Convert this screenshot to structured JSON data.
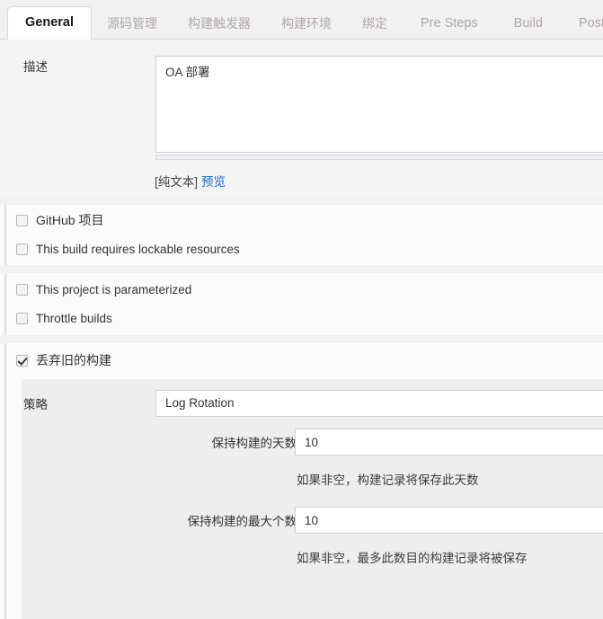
{
  "tabs": [
    {
      "label": "General",
      "active": true,
      "cjk": false
    },
    {
      "label": "源码管理",
      "active": false,
      "cjk": true
    },
    {
      "label": "构建触发器",
      "active": false,
      "cjk": true
    },
    {
      "label": "构建环境",
      "active": false,
      "cjk": true
    },
    {
      "label": "绑定",
      "active": false,
      "cjk": true
    },
    {
      "label": "Pre Steps",
      "active": false,
      "cjk": false
    },
    {
      "label": "Build",
      "active": false,
      "cjk": false
    },
    {
      "label": "Post Steps",
      "active": false,
      "cjk": false
    }
  ],
  "description": {
    "label": "描述",
    "value": "OA 部署",
    "placeholder": "",
    "plain_text_note": "[纯文本]",
    "preview_link": "预览"
  },
  "checkboxes": [
    {
      "label": "GitHub 项目",
      "checked": false,
      "cjk": true
    },
    {
      "label": "This build requires lockable resources",
      "checked": false,
      "cjk": false
    },
    {
      "label": "This project is parameterized",
      "checked": false,
      "cjk": false
    },
    {
      "label": "Throttle builds",
      "checked": false,
      "cjk": false
    },
    {
      "label": "丢弃旧的构建",
      "checked": true,
      "cjk": true
    }
  ],
  "strategy": {
    "label": "策略",
    "selected": "Log Rotation",
    "days_to_keep": {
      "label": "保持构建的天数",
      "value": "10",
      "hint": "如果非空，构建记录将保存此天数"
    },
    "max_to_keep": {
      "label": "保持构建的最大个数",
      "value": "10",
      "hint": "如果非空，最多此数目的构建记录将被保存"
    }
  },
  "watermark": "https://blog.csdn.net/u013343114"
}
